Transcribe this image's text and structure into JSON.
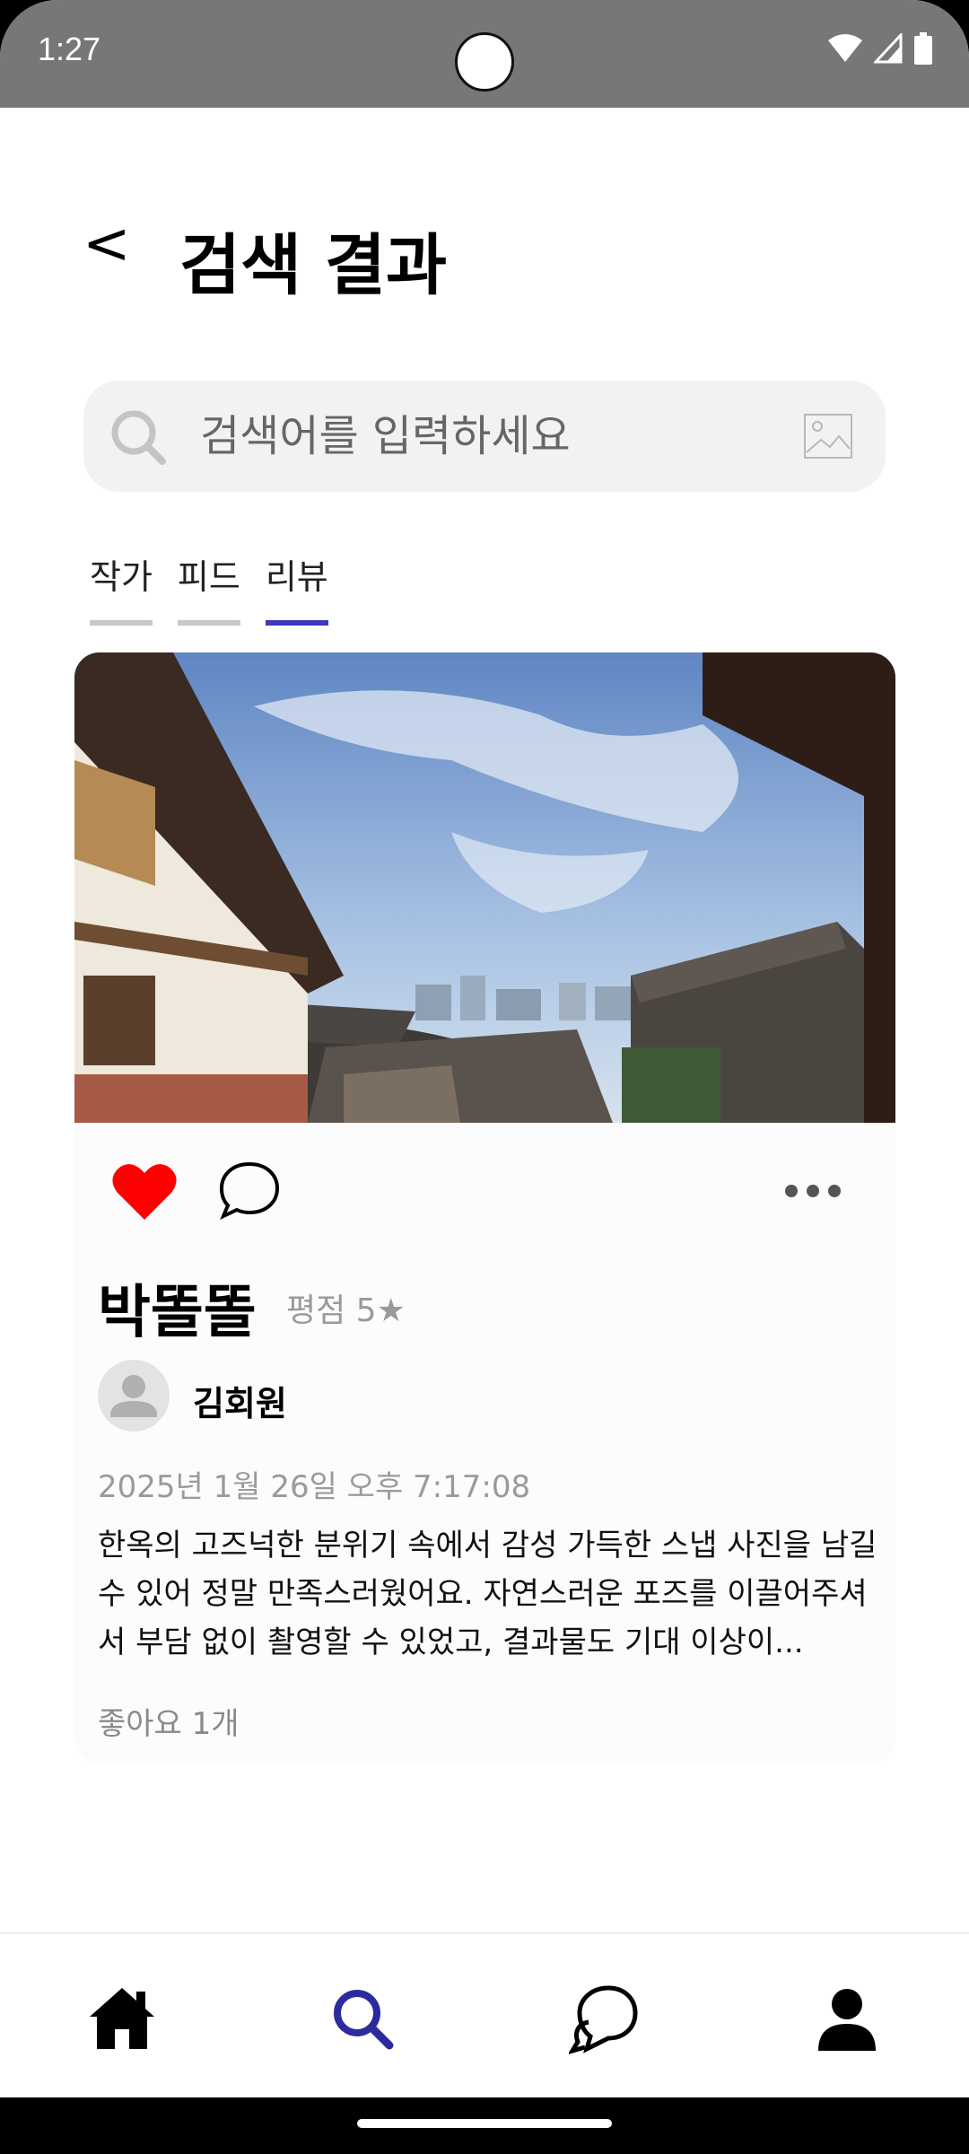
{
  "status_bar": {
    "time": "1:27",
    "icons": [
      "wifi-icon",
      "signal-icon",
      "battery-icon"
    ]
  },
  "header": {
    "back_label": "<",
    "title": "검색 결과"
  },
  "search": {
    "placeholder": "검색어를 입력하세요",
    "value": ""
  },
  "tabs": [
    {
      "label": "작가",
      "active": false
    },
    {
      "label": "피드",
      "active": false
    },
    {
      "label": "리뷰",
      "active": true
    }
  ],
  "review": {
    "liked": true,
    "title": "박똘똘",
    "rating": "평점 5★",
    "author": "김회원",
    "date": "2025년 1월 26일 오후 7:17:08",
    "body": "한옥의 고즈넉한 분위기 속에서 감성 가득한 스냅 사진을 남길 수 있어 정말 만족스러웠어요. 자연스러운 포즈를 이끌어주셔서 부담 없이 촬영할 수 있었고, 결과물도 기대 이상이...",
    "likes": "좋아요 1개"
  },
  "bottom_nav": [
    {
      "icon": "home-icon",
      "active": false
    },
    {
      "icon": "search-icon",
      "active": true
    },
    {
      "icon": "chat-icon",
      "active": false
    },
    {
      "icon": "profile-icon",
      "active": false
    }
  ],
  "colors": {
    "accent": "#3d3ab8",
    "like": "#ff0000",
    "status_bar": "#777777"
  }
}
